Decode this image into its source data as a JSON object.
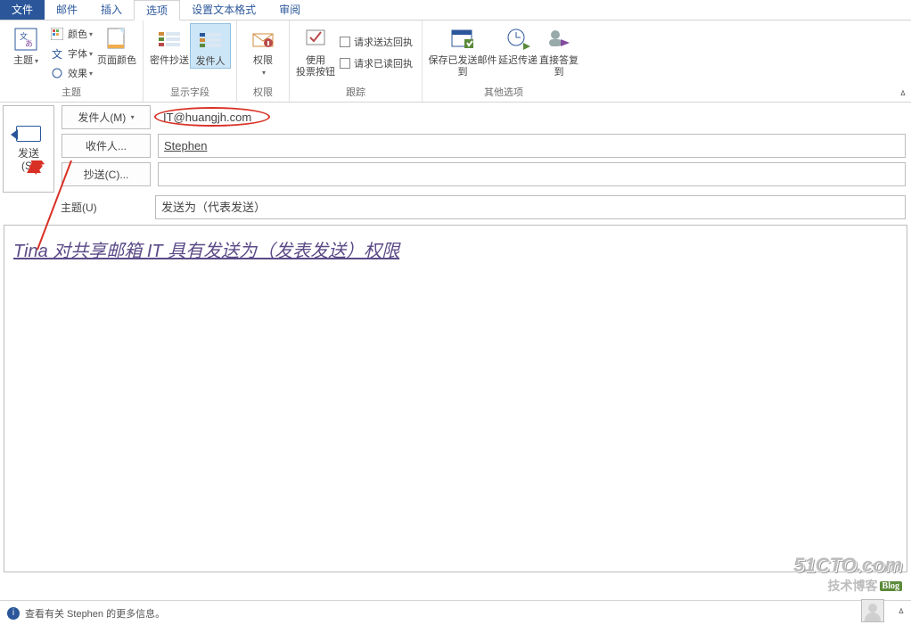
{
  "tabs": {
    "file": "文件",
    "mail": "邮件",
    "insert": "插入",
    "options": "选项",
    "format": "设置文本格式",
    "review": "审阅"
  },
  "ribbon": {
    "theme_group": {
      "theme": "主题",
      "color": "颜色",
      "font": "字体",
      "effect": "效果",
      "pagecolor": "页面颜色",
      "label": "主题"
    },
    "show_group": {
      "bcc": "密件抄送",
      "from": "发件人",
      "label": "显示字段"
    },
    "perm_group": {
      "perm": "权限",
      "label": "权限"
    },
    "vote_group": {
      "vote": "使用\n投票按钮",
      "delivery": "请求送达回执",
      "read": "请求已读回执",
      "label": "跟踪"
    },
    "other_group": {
      "save": "保存已发送邮件\n到",
      "delay": "延迟传递",
      "direct": "直接答复\n到",
      "label": "其他选项"
    }
  },
  "compose": {
    "send": "发送\n(S)",
    "from_btn": "发件人(M)",
    "from_value": "IT@huangjh.com",
    "to_btn": "收件人...",
    "to_value": "Stephen",
    "cc_btn": "抄送(C)...",
    "cc_value": "",
    "subject_lbl": "主题(U)",
    "subject_value": "发送为（代表发送）"
  },
  "body_text": "Tina 对共享邮箱 IT 具有发送为（发表发送）权限",
  "footer_info": "查看有关 Stephen 的更多信息。",
  "watermark": {
    "l1": "51CTO.com",
    "l2": "技术博客",
    "blog": "Blog"
  }
}
